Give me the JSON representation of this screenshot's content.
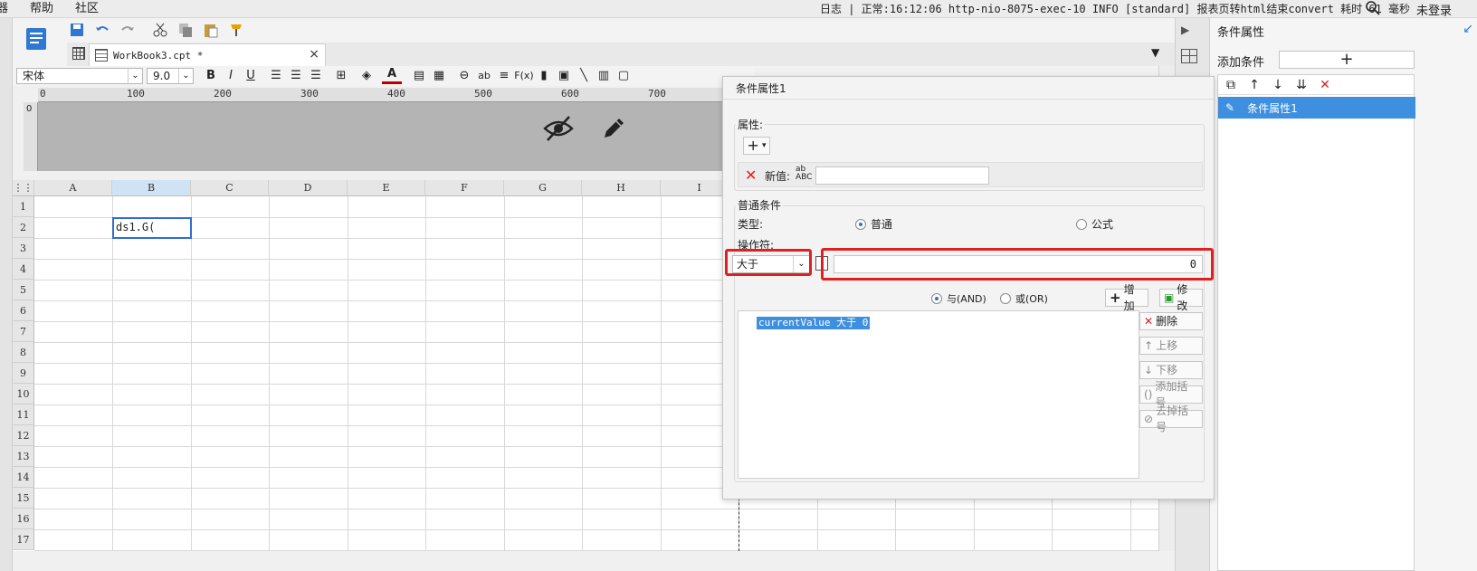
{
  "menubar": {
    "items": [
      "器",
      "帮助",
      "社区"
    ],
    "status": "日志 | 正常:16:12:06 http-nio-8075-exec-10 INFO [standard] 报表页转html结束convert 耗时 61 毫秒",
    "login": "未登录"
  },
  "tab": {
    "title": "WorkBook3.cpt *",
    "close": "×"
  },
  "format": {
    "font": "宋体",
    "size": "9.0"
  },
  "ruler": {
    "ticks": [
      "0",
      "100",
      "200",
      "300",
      "400",
      "500",
      "600",
      "700"
    ],
    "v0": "0"
  },
  "grid": {
    "columns": [
      "A",
      "B",
      "C",
      "D",
      "E",
      "F",
      "G",
      "H",
      "I"
    ],
    "rows": [
      "1",
      "2",
      "3",
      "4",
      "5",
      "6",
      "7",
      "8",
      "9",
      "10",
      "11",
      "12",
      "13",
      "14",
      "15",
      "16",
      "17"
    ],
    "selected_cell_value": "ds1.G("
  },
  "right_panel": {
    "title": "条件属性",
    "add_label": "添加条件",
    "add_button": "+",
    "list_item": "条件属性1"
  },
  "dialog": {
    "title": "条件属性1",
    "attr_group": "属性:",
    "new_value_label": "新值:",
    "normal_group": "普通条件",
    "type_label": "类型:",
    "radio_normal": "普通",
    "radio_formula": "公式",
    "operator_label": "操作符:",
    "operator_value": "大于",
    "operand_value": "0",
    "and_label": "与(AND)",
    "or_label": "或(OR)",
    "add_btn": "增加",
    "modify_btn": "修改",
    "delete_btn": "删除",
    "up_btn": "上移",
    "down_btn": "下移",
    "add_bracket_btn": "添加括号",
    "remove_bracket_btn": "去掉括号",
    "expression": "currentValue 大于 0"
  }
}
